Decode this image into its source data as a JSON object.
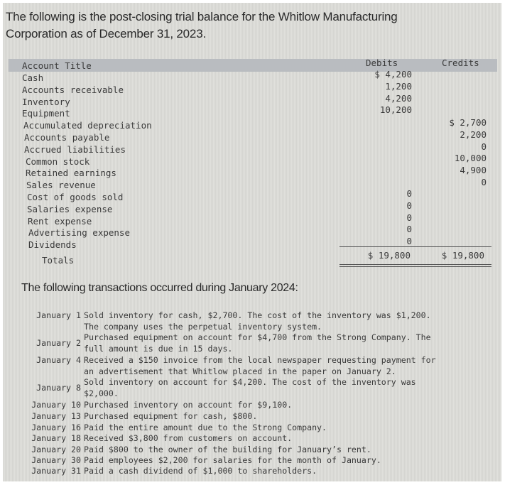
{
  "intro": "The following is the post-closing trial balance for the Whitlow Manufacturing Corporation as of December 31, 2023.",
  "trial_balance": {
    "headers": {
      "account": "Account Title",
      "debits": "Debits",
      "credits": "Credits"
    },
    "accounts": [
      "Cash",
      "Accounts receivable",
      "Inventory",
      "Equipment",
      "Accumulated depreciation",
      "Accounts payable",
      "Accrued liabilities",
      "Common stock",
      "Retained earnings",
      "Sales revenue",
      "Cost of goods sold",
      "Salaries expense",
      "Rent expense",
      "Advertising expense",
      "Dividends"
    ],
    "debits": [
      "$ 4,200",
      "1,200",
      "4,200",
      "10,200"
    ],
    "credits": [
      "$ 2,700",
      "2,200",
      "0",
      "10,000",
      "4,900",
      "0"
    ],
    "expense_debits": [
      "0",
      "0",
      "0",
      "0",
      "0"
    ],
    "totals_label": "Totals",
    "total_debits": "$ 19,800",
    "total_credits": "$ 19,800"
  },
  "transactions_heading": "The following transactions occurred during January 2024:",
  "transactions": [
    {
      "date": "January 1",
      "text": "Sold inventory for cash, $2,700. The cost of the inventory was $1,200.\nThe company uses the perpetual inventory system."
    },
    {
      "date": "January 2",
      "text": "Purchased equipment on account for $4,700 from the Strong Company. The\nfull amount is due in 15 days."
    },
    {
      "date": "January 4",
      "text": "Received a $150 invoice from the local newspaper requesting payment for\nan advertisement that Whitlow placed in the paper on January 2."
    },
    {
      "date": "January 8",
      "text": "Sold inventory on account for $4,200. The cost of the inventory was\n$2,000."
    },
    {
      "date": "January 10",
      "text": "Purchased inventory on account for $9,100."
    },
    {
      "date": "January 13",
      "text": "Purchased equipment for cash, $800."
    },
    {
      "date": "January 16",
      "text": "Paid the entire amount due to the Strong Company."
    },
    {
      "date": "January 18",
      "text": "Received $3,800 from customers on account."
    },
    {
      "date": "January 20",
      "text": "Paid $800 to the owner of the building for January’s rent."
    },
    {
      "date": "January 30",
      "text": "Paid employees $2,200 for salaries for the month of January."
    },
    {
      "date": "January 31",
      "text": "Paid a cash dividend of $1,000 to shareholders."
    }
  ]
}
